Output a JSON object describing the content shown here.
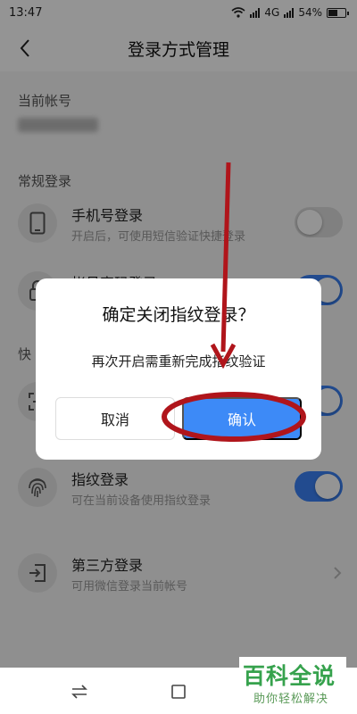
{
  "status_bar": {
    "time": "13:47",
    "network": "4G",
    "battery": "54%"
  },
  "nav": {
    "title": "登录方式管理",
    "back_icon": "chevron-left-icon"
  },
  "account": {
    "label": "当前帐号"
  },
  "sections": {
    "regular": "常规登录",
    "quick": "快"
  },
  "items": [
    {
      "title": "手机号登录",
      "subtitle": "开启后，可使用短信验证快捷登录",
      "icon": "phone-icon",
      "toggle_on": false
    },
    {
      "title": "帐号密码登录",
      "subtitle": "",
      "icon": "lock-icon",
      "toggle_on": true
    },
    {
      "title": "",
      "subtitle": "",
      "icon": "face-scan-icon",
      "toggle_on": true
    },
    {
      "title": "指纹登录",
      "subtitle": "可在当前设备使用指纹登录",
      "icon": "fingerprint-icon",
      "toggle_on": true
    },
    {
      "title": "第三方登录",
      "subtitle": "可用微信登录当前帐号",
      "icon": "login-arrow-icon"
    }
  ],
  "dialog": {
    "title": "确定关闭指纹登录？",
    "message": "再次开启需重新完成指纹验证",
    "cancel": "取消",
    "confirm": "确认"
  },
  "colors": {
    "accent": "#3d8af7",
    "annotation": "#b0151b",
    "watermark": "#36a24d"
  },
  "watermark": {
    "title": "百科全说",
    "subtitle": "助你轻松解决"
  }
}
